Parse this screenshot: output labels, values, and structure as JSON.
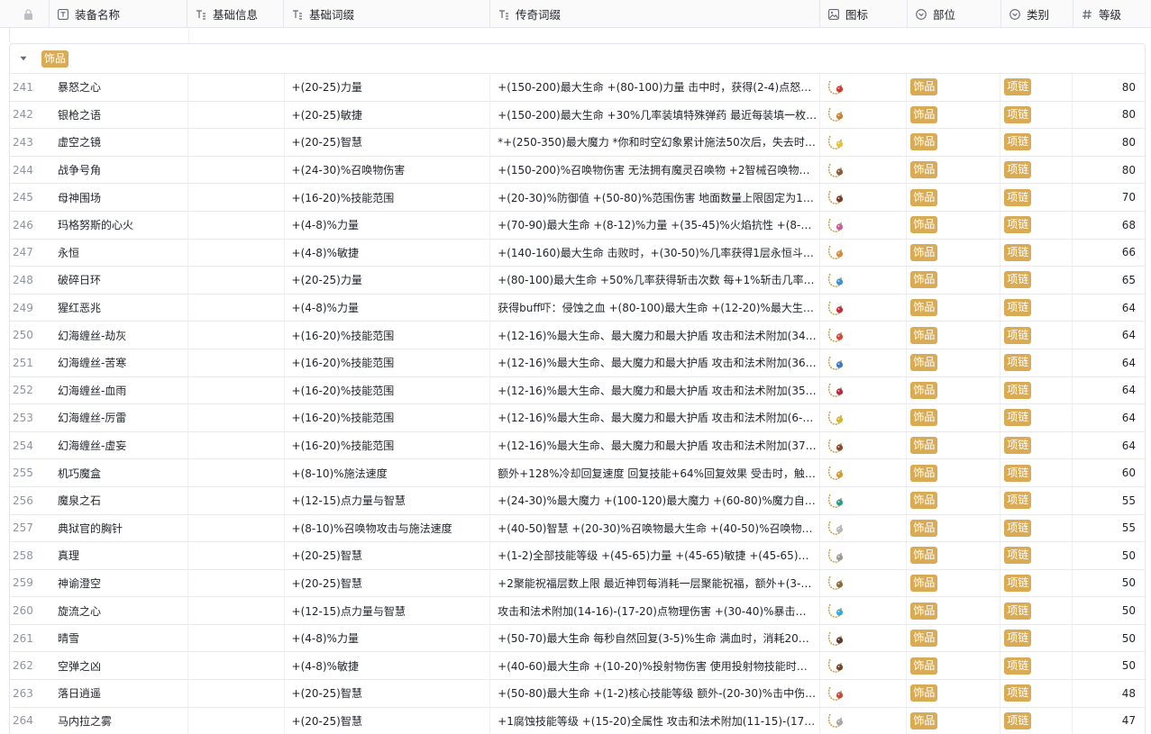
{
  "columns": {
    "name": "装备名称",
    "base_info": "基础信息",
    "base_affix": "基础词缀",
    "legend_affix": "传奇词缀",
    "icon": "图标",
    "part": "部位",
    "category": "类别",
    "level": "等级"
  },
  "group": {
    "label": "饰品"
  },
  "colors": {
    "tag": "#d9ab55",
    "border": "#e5e6eb",
    "header_bg": "#fafafa"
  },
  "rows": [
    {
      "idx": "241",
      "name": "暴怒之心",
      "base": "",
      "affix": "+(20-25)力量",
      "legend": "+(150-200)最大生命 +(80-100)力量 击中时，获得(2-4)点怒气，该怒气...",
      "part": "饰品",
      "cat": "项链",
      "level": "80",
      "gem": "#d8342c"
    },
    {
      "idx": "242",
      "name": "银枪之语",
      "base": "",
      "affix": "+(20-25)敏捷",
      "legend": "+(150-200)最大生命 +30%几率装填特殊弹药 最近每装填一枚特殊弹药...",
      "part": "饰品",
      "cat": "项链",
      "level": "80",
      "gem": "#c9822f"
    },
    {
      "idx": "243",
      "name": "虚空之镜",
      "base": "",
      "affix": "+(20-25)智慧",
      "legend": "*+(250-350)最大魔力 *你和时空幻象累计施法50次后，失去时空幻象...",
      "part": "饰品",
      "cat": "项链",
      "level": "80",
      "gem": "#e6c23a"
    },
    {
      "idx": "244",
      "name": "战争号角",
      "base": "",
      "affix": "+(24-30)%召唤物伤害",
      "legend": "+(150-200)%召唤物伤害 无法拥有魔灵召唤物 +2智械召唤物最大数量...",
      "part": "饰品",
      "cat": "项链",
      "level": "80",
      "gem": "#8a5a3a"
    },
    {
      "idx": "245",
      "name": "母神围场",
      "base": "",
      "affix": "+(16-20)%技能范围",
      "legend": "+(20-30)%防御值 +(50-80)%范围伤害 地面数量上限固定为1 +2地面...",
      "part": "饰品",
      "cat": "项链",
      "level": "70",
      "gem": "#7a3a2a"
    },
    {
      "idx": "246",
      "name": "玛格努斯的心火",
      "base": "",
      "affix": "+(4-8)%力量",
      "legend": "+(70-90)最大生命 +(8-12)%力量 +(35-45)%火焰抗性 +(8-12)%火焰...",
      "part": "饰品",
      "cat": "项链",
      "level": "68",
      "gem": "#c85a9a"
    },
    {
      "idx": "247",
      "name": "永恒",
      "base": "",
      "affix": "+(4-8)%敏捷",
      "legend": "+(140-160)最大生命 击败时，+(30-50)%几率获得1层永恒斗志 击...",
      "part": "饰品",
      "cat": "项链",
      "level": "66",
      "gem": "#d48a3a"
    },
    {
      "idx": "248",
      "name": "破碎日环",
      "base": "",
      "affix": "+(20-25)力量",
      "legend": "+(80-100)最大生命 +50%几率获得斩击次数 每+1%斩击几率，+2...",
      "part": "饰品",
      "cat": "项链",
      "level": "65",
      "gem": "#3a8ed4"
    },
    {
      "idx": "249",
      "name": "猩红恶兆",
      "base": "",
      "affix": "+(4-8)%力量",
      "legend": "获得buff吓：侵蚀之血 +(80-100)最大生命 +(12-20)%最大生命 +(12...",
      "part": "饰品",
      "cat": "项链",
      "level": "64",
      "gem": "#c8283a"
    },
    {
      "idx": "250",
      "name": "幻海缠丝-劫灰",
      "base": "",
      "affix": "+(16-20)%技能范围",
      "legend": "+(12-16)%最大生命、最大魔力和最大护盾 攻击和法术附加(34-37)...",
      "part": "饰品",
      "cat": "项链",
      "level": "64",
      "gem": "#d4463a"
    },
    {
      "idx": "251",
      "name": "幻海缠丝-苦寒",
      "base": "",
      "affix": "+(16-20)%技能范围",
      "legend": "+(12-16)%最大生命、最大魔力和最大护盾 攻击和法术附加(36-38)...",
      "part": "饰品",
      "cat": "项链",
      "level": "64",
      "gem": "#3a7ac8"
    },
    {
      "idx": "252",
      "name": "幻海缠丝-血雨",
      "base": "",
      "affix": "+(16-20)%技能范围",
      "legend": "+(12-16)%最大生命、最大魔力和最大护盾 攻击和法术附加(35-38)...",
      "part": "饰品",
      "cat": "项链",
      "level": "64",
      "gem": "#b8283a"
    },
    {
      "idx": "253",
      "name": "幻海缠丝-厉雷",
      "base": "",
      "affix": "+(16-20)%技能范围",
      "legend": "+(12-16)%最大生命、最大魔力和最大护盾 攻击和法术附加(6-9)-(7...",
      "part": "饰品",
      "cat": "项链",
      "level": "64",
      "gem": "#d8b42c"
    },
    {
      "idx": "254",
      "name": "幻海缠丝-虚妄",
      "base": "",
      "affix": "+(16-20)%技能范围",
      "legend": "+(12-16)%最大生命、最大魔力和最大护盾 攻击和法术附加(37-39)...",
      "part": "饰品",
      "cat": "项链",
      "level": "64",
      "gem": "#8a4a2a"
    },
    {
      "idx": "255",
      "name": "机巧魔盒",
      "base": "",
      "affix": "+(8-10)%施法速度",
      "legend": "额外+128%冷却回复速度 回复技能+64%回复效果 受击时，触发第...",
      "part": "饰品",
      "cat": "项链",
      "level": "60",
      "gem": "#d89a2c"
    },
    {
      "idx": "256",
      "name": "魔泉之石",
      "base": "",
      "affix": "+(12-15)点力量与智慧",
      "legend": "+(24-30)%最大魔力 +(100-120)最大魔力 +(60-80)%魔力自然回复...",
      "part": "饰品",
      "cat": "项链",
      "level": "55",
      "gem": "#2c9a8a"
    },
    {
      "idx": "257",
      "name": "典狱官的胸针",
      "base": "",
      "affix": "+(8-10)%召唤物攻击与施法速度",
      "legend": "+(40-50)智慧 +(20-30)%召唤物最大生命 +(40-50)%召唤物伤害 你...",
      "part": "饰品",
      "cat": "项链",
      "level": "55",
      "gem": "#b8b8b8"
    },
    {
      "idx": "258",
      "name": "真理",
      "base": "",
      "affix": "+(20-25)智慧",
      "legend": "+(1-2)全部技能等级 +(45-65)力量 +(45-65)敏捷 +(45-65)智慧 +25...",
      "part": "饰品",
      "cat": "项链",
      "level": "50",
      "gem": "#9a9a9a"
    },
    {
      "idx": "259",
      "name": "神谕澄空",
      "base": "",
      "affix": "+(20-25)智慧",
      "legend": "+2聚能祝福层数上限 最近神罚每消耗一层聚能祝福，额外+(3-5)%...",
      "part": "饰品",
      "cat": "项链",
      "level": "50",
      "gem": "#8a6a3a"
    },
    {
      "idx": "260",
      "name": "旋流之心",
      "base": "",
      "affix": "+(12-15)点力量与智慧",
      "legend": "攻击和法术附加(14-16)-(17-20)点物理伤害 +(30-40)%暴击伤害 +(...",
      "part": "饰品",
      "cat": "项链",
      "level": "50",
      "gem": "#3aa8d4"
    },
    {
      "idx": "261",
      "name": "晴雪",
      "base": "",
      "affix": "+(4-8)%力量",
      "legend": "+(50-70)最大生命 每秒自然回复(3-5)%生命 满血时，消耗20%最大...",
      "part": "饰品",
      "cat": "项链",
      "level": "50",
      "gem": "#5a3a2a"
    },
    {
      "idx": "262",
      "name": "空弹之凶",
      "base": "",
      "affix": "+(4-8)%敏捷",
      "legend": "+(40-60)最大生命 +(10-20)%投射物伤害 使用投射物技能时，该次...",
      "part": "饰品",
      "cat": "项链",
      "level": "50",
      "gem": "#6a4a2a"
    },
    {
      "idx": "263",
      "name": "落日逍遥",
      "base": "",
      "affix": "+(20-25)智慧",
      "legend": "+(50-80)最大生命 +(1-2)核心技能等级 额外-(20-30)%击中伤害 最...",
      "part": "饰品",
      "cat": "项链",
      "level": "48",
      "gem": "#c8483a"
    },
    {
      "idx": "264",
      "name": "马内拉之雾",
      "base": "",
      "affix": "+(20-25)智慧",
      "legend": "+1腐蚀技能等级 +(15-20)全属性 攻击和法术附加(11-15)-(17-21)点...",
      "part": "饰品",
      "cat": "项链",
      "level": "47",
      "gem": "#a8a8a8"
    }
  ]
}
